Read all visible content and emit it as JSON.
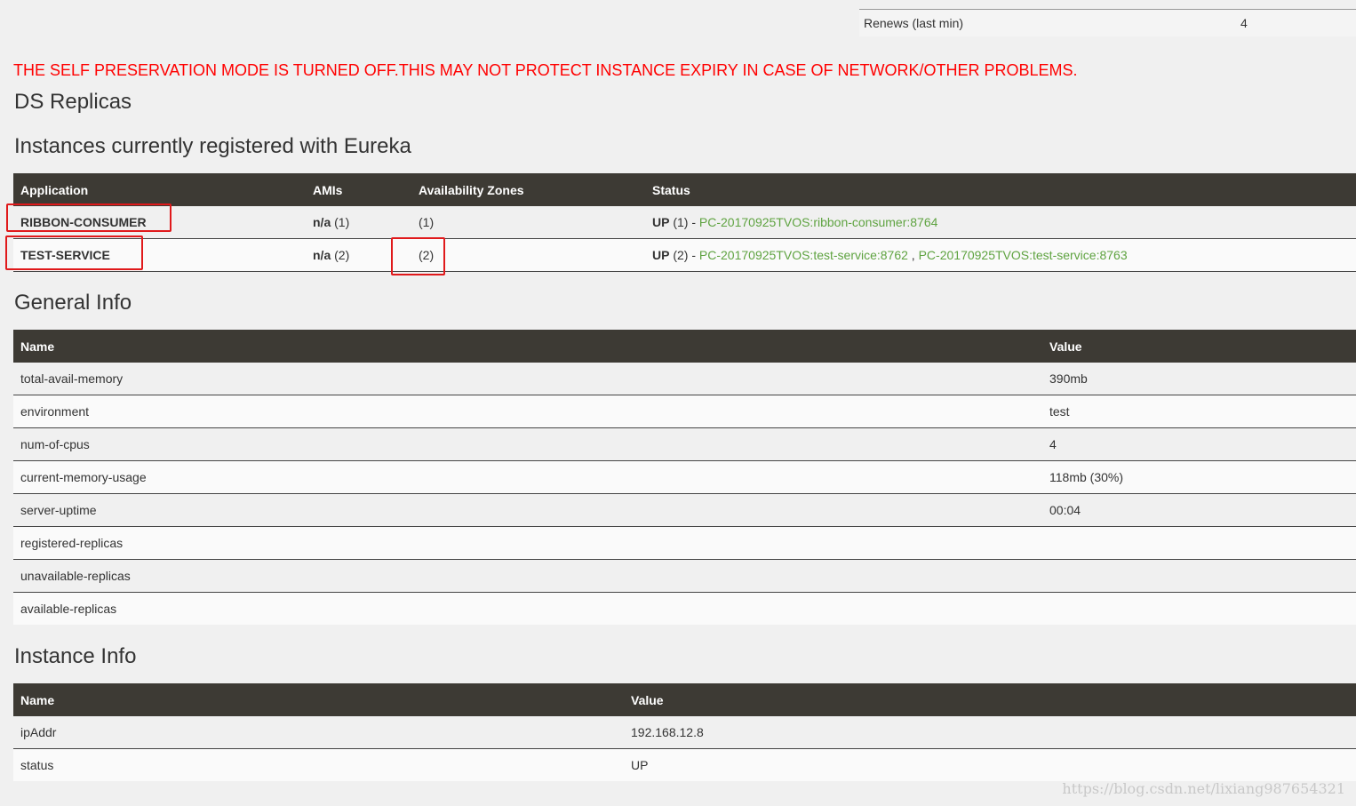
{
  "renews": {
    "label": "Renews (last min)",
    "value": "4"
  },
  "warning": "THE SELF PRESERVATION MODE IS TURNED OFF.THIS MAY NOT PROTECT INSTANCE EXPIRY IN CASE OF NETWORK/OTHER PROBLEMS.",
  "headings": {
    "ds_replicas": "DS Replicas",
    "instances": "Instances currently registered with Eureka",
    "general_info": "General Info",
    "instance_info": "Instance Info"
  },
  "instances": {
    "columns": [
      "Application",
      "AMIs",
      "Availability Zones",
      "Status"
    ],
    "rows": [
      {
        "app": "RIBBON-CONSUMER",
        "ami_na": "n/a",
        "ami_count": "(1)",
        "zones": "(1)",
        "status_up": "UP",
        "status_count": "(1) - ",
        "links": [
          "PC-20170925TVOS:ribbon-consumer:8764"
        ]
      },
      {
        "app": "TEST-SERVICE",
        "ami_na": "n/a",
        "ami_count": "(2)",
        "zones": "(2)",
        "status_up": "UP",
        "status_count": "(2) - ",
        "links": [
          "PC-20170925TVOS:test-service:8762",
          "PC-20170925TVOS:test-service:8763"
        ]
      }
    ]
  },
  "general_info": {
    "columns": [
      "Name",
      "Value"
    ],
    "rows": [
      {
        "name": "total-avail-memory",
        "value": "390mb"
      },
      {
        "name": "environment",
        "value": "test"
      },
      {
        "name": "num-of-cpus",
        "value": "4"
      },
      {
        "name": "current-memory-usage",
        "value": "118mb (30%)"
      },
      {
        "name": "server-uptime",
        "value": "00:04"
      },
      {
        "name": "registered-replicas",
        "value": ""
      },
      {
        "name": "unavailable-replicas",
        "value": ""
      },
      {
        "name": "available-replicas",
        "value": ""
      }
    ]
  },
  "instance_info": {
    "columns": [
      "Name",
      "Value"
    ],
    "rows": [
      {
        "name": "ipAddr",
        "value": "192.168.12.8"
      },
      {
        "name": "status",
        "value": "UP"
      }
    ]
  },
  "watermark": "https://blog.csdn.net/lixiang987654321",
  "colors": {
    "header_bg": "#3d3a34",
    "warning": "#ff0000",
    "link": "#5fa341",
    "highlight_box": "#e0191b"
  }
}
